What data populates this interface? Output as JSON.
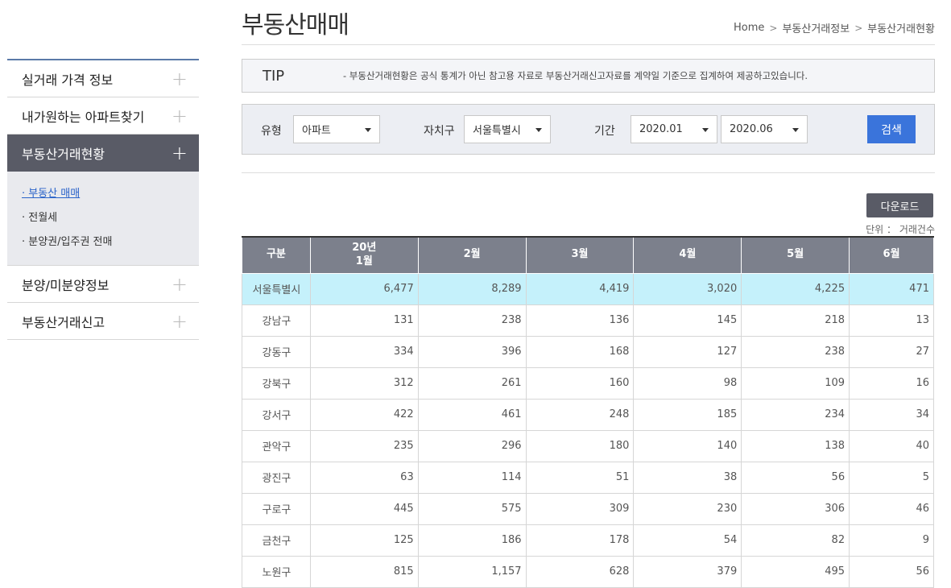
{
  "page": {
    "title": "부동산매매",
    "breadcrumb": [
      "Home",
      "부동산거래정보",
      "부동산거래현황"
    ]
  },
  "sidebar": {
    "items": [
      {
        "label": "실거래 가격 정보"
      },
      {
        "label": "내가원하는 아파트찾기"
      },
      {
        "label": "부동산거래현황"
      },
      {
        "label": "분양/미분양정보"
      },
      {
        "label": "부동산거래신고"
      }
    ],
    "submenu": [
      "· 부동산 매매",
      "· 전월세",
      "· 분양권/입주권 전매"
    ]
  },
  "tip": {
    "label": "TIP",
    "text": "- 부동산거래현황은 공식 통계가 아닌 참고용 자료로 부동산거래신고자료를 계약일 기준으로 집계하여 제공하고있습니다."
  },
  "search": {
    "type_label": "유형",
    "type_value": "아파트",
    "district_label": "자치구",
    "district_value": "서울특별시",
    "period_label": "기간",
    "period_from": "2020.01",
    "period_to": "2020.06",
    "button": "검색"
  },
  "download_label": "다운로드",
  "unit_label": "단위 ： 거래건수",
  "table": {
    "headers": [
      "구분",
      "20년\n1월",
      "2월",
      "3월",
      "4월",
      "5월",
      "6월"
    ],
    "rows": [
      [
        "서울특별시",
        "6,477",
        "8,289",
        "4,419",
        "3,020",
        "4,225",
        "471"
      ],
      [
        "강남구",
        "131",
        "238",
        "136",
        "145",
        "218",
        "13"
      ],
      [
        "강동구",
        "334",
        "396",
        "168",
        "127",
        "238",
        "27"
      ],
      [
        "강북구",
        "312",
        "261",
        "160",
        "98",
        "109",
        "16"
      ],
      [
        "강서구",
        "422",
        "461",
        "248",
        "185",
        "234",
        "34"
      ],
      [
        "관악구",
        "235",
        "296",
        "180",
        "140",
        "138",
        "40"
      ],
      [
        "광진구",
        "63",
        "114",
        "51",
        "38",
        "56",
        "5"
      ],
      [
        "구로구",
        "445",
        "575",
        "309",
        "230",
        "306",
        "46"
      ],
      [
        "금천구",
        "125",
        "186",
        "178",
        "54",
        "82",
        "9"
      ],
      [
        "노원구",
        "815",
        "1,157",
        "628",
        "379",
        "495",
        "56"
      ]
    ]
  }
}
